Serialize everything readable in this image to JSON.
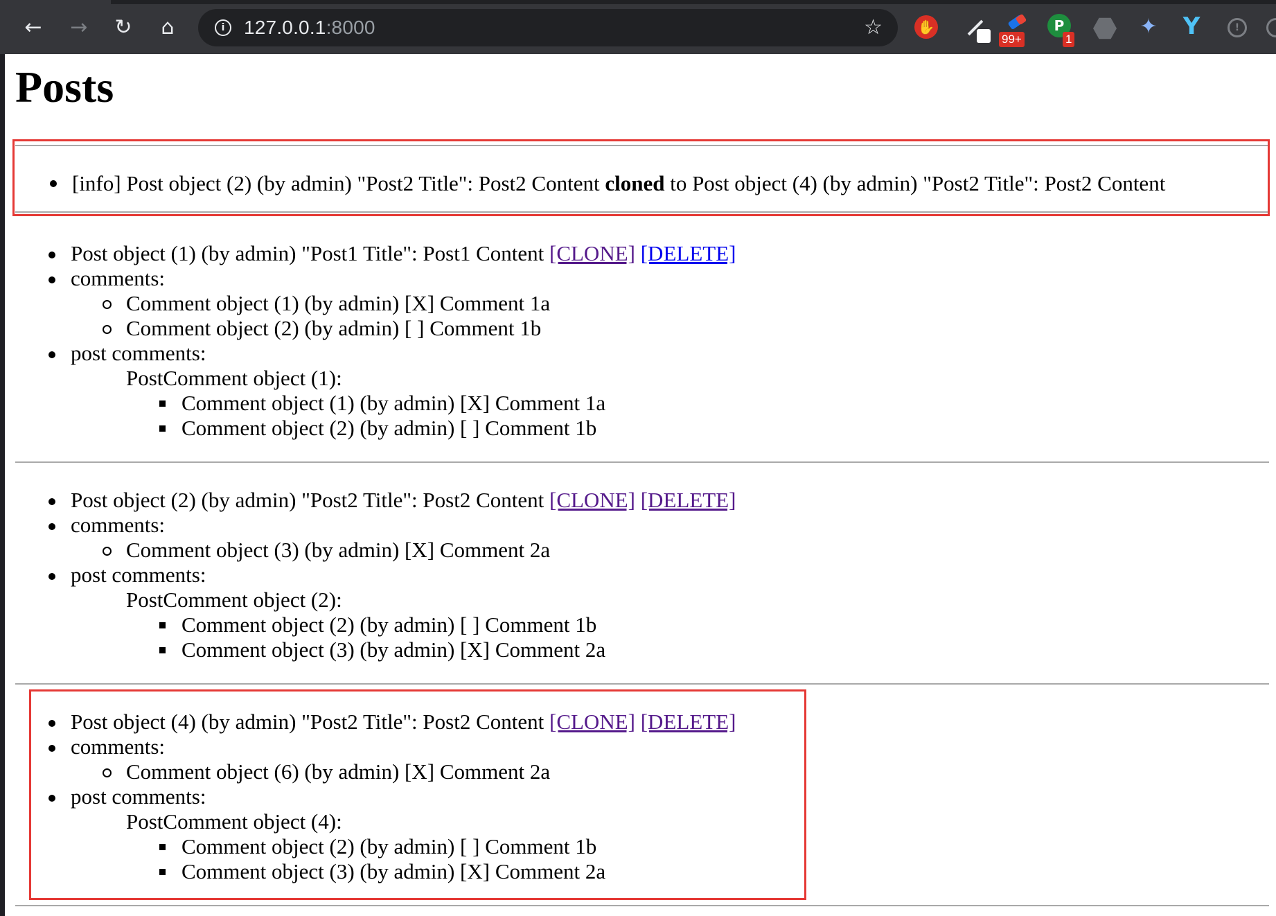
{
  "browser": {
    "url_host": "127.0.0.1",
    "url_port": ":8000",
    "badges": {
      "extension_count": "99+",
      "notification_count": "1"
    },
    "icons": [
      "back-arrow-icon",
      "forward-arrow-icon",
      "reload-icon",
      "home-icon",
      "info-icon",
      "star-icon"
    ]
  },
  "page": {
    "title": "Posts",
    "message": {
      "prefix": "[info] Post object (2) (by admin) \"Post2 Title\": Post2 Content ",
      "verb": "cloned",
      "suffix": " to Post object (4) (by admin) \"Post2 Title\": Post2 Content"
    },
    "labels": {
      "comments": "comments:",
      "post_comments": "post comments:"
    },
    "actions": {
      "clone": "[CLONE]",
      "delete": "[DELETE]"
    },
    "posts": [
      {
        "title": "Post object (1) (by admin) \"Post1 Title\": Post1 Content",
        "comments": [
          "Comment object (1) (by admin) [X] Comment 1a",
          "Comment object (2) (by admin) [ ] Comment 1b"
        ],
        "postcomment_label": "PostComment object (1):",
        "postcomments": [
          "Comment object (1) (by admin) [X] Comment 1a",
          "Comment object (2) (by admin) [ ] Comment 1b"
        ]
      },
      {
        "title": "Post object (2) (by admin) \"Post2 Title\": Post2 Content",
        "comments": [
          "Comment object (3) (by admin) [X] Comment 2a"
        ],
        "postcomment_label": "PostComment object (2):",
        "postcomments": [
          "Comment object (2) (by admin) [ ] Comment 1b",
          "Comment object (3) (by admin) [X] Comment 2a"
        ]
      },
      {
        "title": "Post object (4) (by admin) \"Post2 Title\": Post2 Content",
        "comments": [
          "Comment object (6) (by admin) [X] Comment 2a"
        ],
        "postcomment_label": "PostComment object (4):",
        "postcomments": [
          "Comment object (2) (by admin) [ ] Comment 1b",
          "Comment object (3) (by admin) [X] Comment 2a"
        ]
      }
    ]
  },
  "colors": {
    "chrome_bg": "#35363a",
    "omnibox_bg": "#202124",
    "link_visited": "#551a8b",
    "link_unvisited": "#0000ee",
    "highlight_border": "#e53935",
    "rule": "#a9a9a9"
  }
}
